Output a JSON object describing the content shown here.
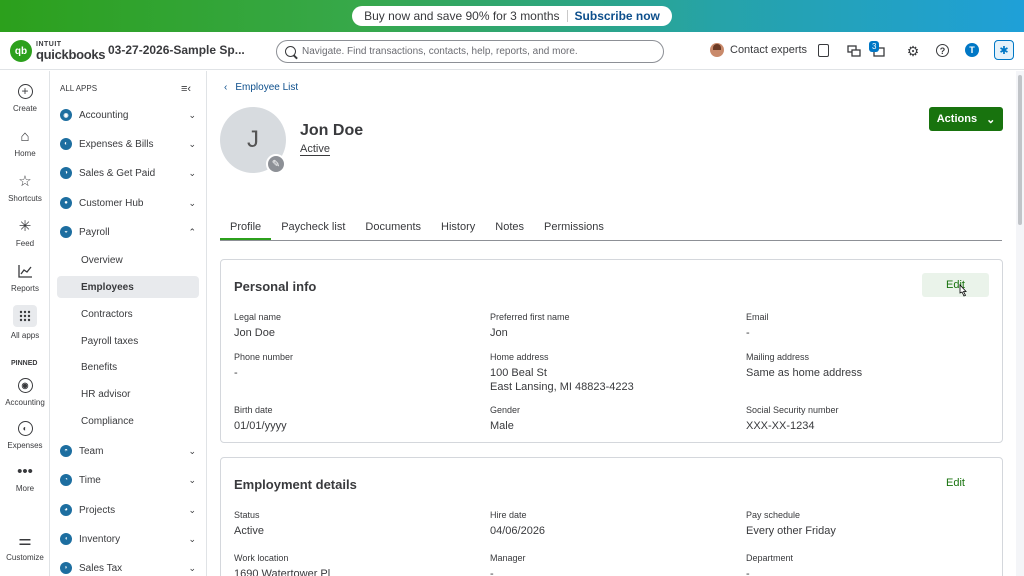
{
  "promo": {
    "text": "Buy now and save 90% for 3 months",
    "link": "Subscribe now"
  },
  "header": {
    "logo_intuit": "INTUIT",
    "logo_quickbooks": "quickbooks",
    "logo_mark": "qb",
    "company_name": "03-27-2026-Sample Sp...",
    "search_placeholder": "Navigate. Find transactions, contacts, help, reports, and more.",
    "contact_experts": "Contact experts",
    "notification_count": "3",
    "user_initial": "T",
    "icons": [
      "clipboard-icon",
      "chat-icon",
      "notifications-icon",
      "gear-icon",
      "help-icon",
      "assistant-icon"
    ]
  },
  "rail": {
    "items": [
      {
        "label": "Create",
        "icon": "plus-circle-icon"
      },
      {
        "label": "Home",
        "icon": "home-icon"
      },
      {
        "label": "Shortcuts",
        "icon": "star-icon"
      },
      {
        "label": "Feed",
        "icon": "sparkle-icon"
      },
      {
        "label": "Reports",
        "icon": "chart-icon"
      },
      {
        "label": "All apps",
        "icon": "grid-icon"
      }
    ],
    "pinned_heading": "PINNED",
    "pinned": [
      {
        "label": "Accounting",
        "icon": "accounting-icon"
      },
      {
        "label": "Expenses",
        "icon": "expenses-icon"
      },
      {
        "label": "More",
        "icon": "more-icon"
      }
    ],
    "customize": "Customize"
  },
  "appnav": {
    "heading": "ALL APPS",
    "items": [
      {
        "label": "Accounting",
        "color": "#1a6f9a"
      },
      {
        "label": "Expenses & Bills",
        "color": "#1a6f9a"
      },
      {
        "label": "Sales & Get Paid",
        "color": "#1a6f9a"
      },
      {
        "label": "Customer Hub",
        "color": "#1a6f9a"
      },
      {
        "label": "Payroll",
        "color": "#1a6f9a"
      }
    ],
    "payroll_sub": [
      "Overview",
      "Employees",
      "Contractors",
      "Payroll taxes",
      "Benefits",
      "HR advisor",
      "Compliance"
    ],
    "items_after": [
      {
        "label": "Team",
        "color": "#1a6f9a"
      },
      {
        "label": "Time",
        "color": "#1a6f9a"
      },
      {
        "label": "Projects",
        "color": "#1a6f9a"
      },
      {
        "label": "Inventory",
        "color": "#1a6f9a"
      },
      {
        "label": "Sales Tax",
        "color": "#1a6f9a"
      }
    ]
  },
  "main": {
    "back_link": "Employee List",
    "avatar_initial": "J",
    "employee_name": "Jon Doe",
    "employee_status": "Active",
    "actions_label": "Actions",
    "tabs": [
      "Profile",
      "Paycheck list",
      "Documents",
      "History",
      "Notes",
      "Permissions"
    ],
    "personal_info": {
      "title": "Personal info",
      "edit": "Edit",
      "fields": [
        {
          "label": "Legal name",
          "value": "Jon Doe"
        },
        {
          "label": "Preferred first name",
          "value": "Jon"
        },
        {
          "label": "Email",
          "value": "-"
        },
        {
          "label": "Phone number",
          "value": "-"
        },
        {
          "label": "Home address",
          "value": "100 Beal St",
          "value2": "East Lansing, MI 48823-4223"
        },
        {
          "label": "Mailing address",
          "value": "Same as home address"
        },
        {
          "label": "Birth date",
          "value": "01/01/yyyy"
        },
        {
          "label": "Gender",
          "value": "Male"
        },
        {
          "label": "Social Security number",
          "value": "XXX-XX-1234"
        }
      ]
    },
    "employment": {
      "title": "Employment details",
      "edit": "Edit",
      "fields": [
        {
          "label": "Status",
          "value": "Active"
        },
        {
          "label": "Hire date",
          "value": "04/06/2026"
        },
        {
          "label": "Pay schedule",
          "value": "Every other Friday"
        },
        {
          "label": "Work location",
          "value": "1690 Watertower Pl"
        },
        {
          "label": "Manager",
          "value": "-"
        },
        {
          "label": "Department",
          "value": "-"
        }
      ]
    }
  }
}
